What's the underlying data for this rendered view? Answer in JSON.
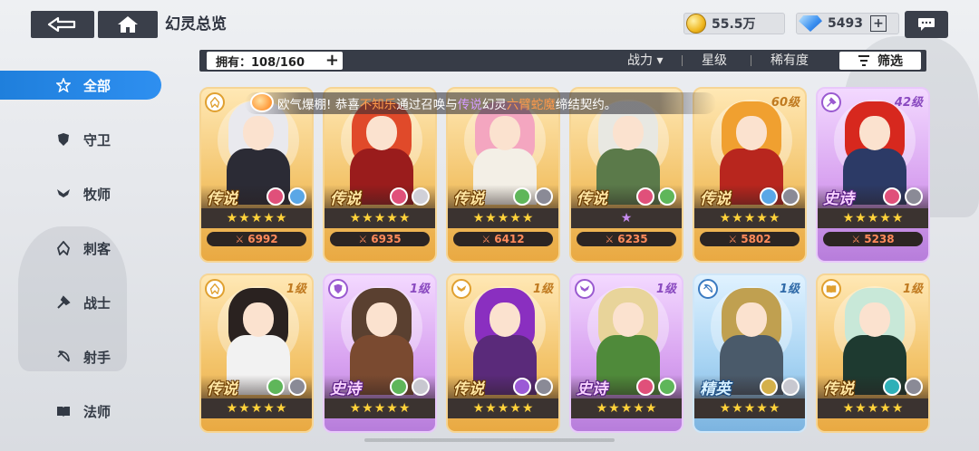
{
  "header": {
    "title": "幻灵总览",
    "gold": "55.5万",
    "gems": "5493",
    "plus": "+"
  },
  "filter": {
    "owned_label": "拥有：108/160",
    "owned_plus": "+",
    "sort_power": "战力 ▾",
    "sort_star": "星级",
    "sort_rarity": "稀有度",
    "filter_button": "筛选"
  },
  "sidebar": {
    "items": [
      {
        "label": "全部",
        "icon": "star-outline-icon"
      },
      {
        "label": "守卫",
        "icon": "shield-icon"
      },
      {
        "label": "牧师",
        "icon": "wings-icon"
      },
      {
        "label": "刺客",
        "icon": "assassin-icon"
      },
      {
        "label": "战士",
        "icon": "axe-icon"
      },
      {
        "label": "射手",
        "icon": "bow-icon"
      },
      {
        "label": "法师",
        "icon": "book-icon"
      }
    ]
  },
  "marquee": {
    "prefix": "欧气爆棚!  恭喜",
    "player": "不知乐",
    "mid1": "通过召唤与",
    "rarity": "传说",
    "mid2": "幻灵",
    "hero": "六臂蛇魔",
    "suffix": "缔结契约。"
  },
  "cards": [
    {
      "rarity": "传说",
      "rarity_class": "legend",
      "color": "gold",
      "level": "",
      "stars": 5,
      "star_color": "yellow",
      "power": "6992",
      "class_icon": "assassin-icon",
      "hair": "#e9e9ee",
      "outfit": "#2b2b35",
      "elements": [
        "#e0507a",
        "#5aa7e6"
      ]
    },
    {
      "rarity": "传说",
      "rarity_class": "legend",
      "color": "gold",
      "level": "",
      "stars": 5,
      "star_color": "yellow",
      "power": "6935",
      "class_icon": "",
      "hair": "#e04a2a",
      "outfit": "#9a1c1c",
      "elements": [
        "#e0507a",
        "#d0d0d8"
      ]
    },
    {
      "rarity": "传说",
      "rarity_class": "legend",
      "color": "gold",
      "level": "",
      "stars": 5,
      "star_color": "yellow",
      "power": "6412",
      "class_icon": "",
      "hair": "#f4a6c0",
      "outfit": "#f3efe6",
      "elements": [
        "#5fb65a",
        "#8a8a96"
      ]
    },
    {
      "rarity": "传说",
      "rarity_class": "legend",
      "color": "gold",
      "level": "",
      "stars": 1,
      "star_color": "purple",
      "power": "6235",
      "class_icon": "",
      "hair": "#e8e8e2",
      "outfit": "#5b7a4a",
      "elements": [
        "#e0507a",
        "#5fb65a"
      ]
    },
    {
      "rarity": "传说",
      "rarity_class": "legend",
      "color": "gold",
      "level": "60级",
      "stars": 5,
      "star_color": "yellow",
      "power": "5802",
      "class_icon": "",
      "hair": "#f0a030",
      "outfit": "#b8261e",
      "elements": [
        "#5aa7e6",
        "#8a8a96"
      ]
    },
    {
      "rarity": "史诗",
      "rarity_class": "epic",
      "color": "purple",
      "level": "42级",
      "stars": 5,
      "star_color": "yellow",
      "power": "5238",
      "class_icon": "axe-icon",
      "hair": "#d7281e",
      "outfit": "#2c3a66",
      "elements": [
        "#e0507a",
        "#8a8a96"
      ]
    },
    {
      "rarity": "传说",
      "rarity_class": "legend",
      "color": "gold",
      "level": "1级",
      "stars": 5,
      "star_color": "yellow",
      "power": "",
      "class_icon": "assassin-icon",
      "hair": "#2a2220",
      "outfit": "#f2f2f2",
      "elements": [
        "#5fb65a",
        "#8a8a96"
      ]
    },
    {
      "rarity": "史诗",
      "rarity_class": "epic",
      "color": "purple",
      "level": "1级",
      "stars": 5,
      "star_color": "yellow",
      "power": "",
      "class_icon": "shield-icon",
      "hair": "#5a4030",
      "outfit": "#7a4a30",
      "elements": [
        "#5fb65a",
        "#c8c8d0"
      ]
    },
    {
      "rarity": "传说",
      "rarity_class": "legend",
      "color": "gold",
      "level": "1级",
      "stars": 5,
      "star_color": "yellow",
      "power": "",
      "class_icon": "wings-icon",
      "hair": "#8a2fc0",
      "outfit": "#5a2a7a",
      "elements": [
        "#9b5ad6",
        "#8a8a96"
      ]
    },
    {
      "rarity": "史诗",
      "rarity_class": "epic",
      "color": "purple",
      "level": "1级",
      "stars": 5,
      "star_color": "yellow",
      "power": "",
      "class_icon": "wings-icon",
      "hair": "#e8d49a",
      "outfit": "#4f8a3a",
      "elements": [
        "#e0507a",
        "#5fb65a"
      ]
    },
    {
      "rarity": "精英",
      "rarity_class": "elite",
      "color": "blue",
      "level": "1级",
      "stars": 5,
      "star_color": "yellow",
      "power": "",
      "class_icon": "bow-icon",
      "hair": "#c0a050",
      "outfit": "#4a5a6a",
      "elements": [
        "#d4b04a",
        "#c8c8d0"
      ]
    },
    {
      "rarity": "传说",
      "rarity_class": "legend",
      "color": "gold",
      "level": "1级",
      "stars": 5,
      "star_color": "yellow",
      "power": "",
      "class_icon": "book-icon",
      "hair": "#c8e8d8",
      "outfit": "#1e3a30",
      "elements": [
        "#2fb0b8",
        "#8a8a96"
      ]
    }
  ]
}
